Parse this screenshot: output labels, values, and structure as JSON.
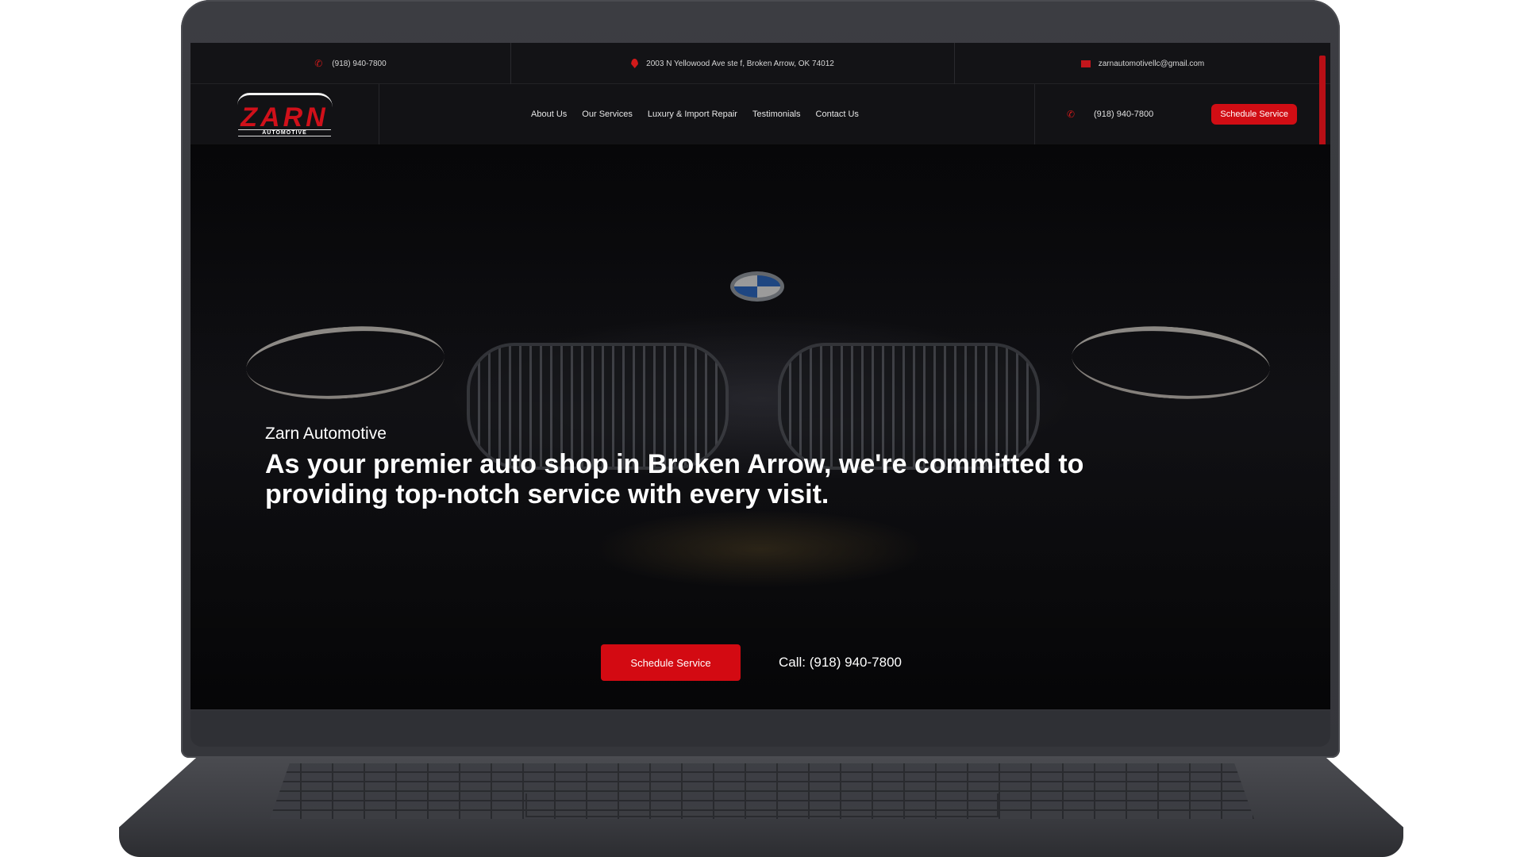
{
  "topbar": {
    "phone": "(918) 940-7800",
    "address": "2003 N Yellowood Ave ste f, Broken Arrow, OK 74012",
    "email": "zarnautomotivellc@gmail.com"
  },
  "brand": {
    "logo_text": "ZARN",
    "logo_subtext": "AUTOMOTIVE",
    "accent_color": "#d10d14"
  },
  "nav": {
    "items": [
      {
        "label": "About Us"
      },
      {
        "label": "Our Services"
      },
      {
        "label": "Luxury & Import Repair"
      },
      {
        "label": "Testimonials"
      },
      {
        "label": "Contact Us"
      }
    ],
    "phone": "(918) 940-7800",
    "cta_label": "Schedule Service"
  },
  "hero": {
    "kicker": "Zarn Automotive",
    "headline": "As your premier auto shop in Broken Arrow, we're committed to providing top-notch service with every visit.",
    "cta_label": "Schedule Service",
    "call_text": "Call: (918) 940-7800"
  },
  "icons": {
    "phone": "phone-icon",
    "location": "map-pin-icon",
    "email": "mail-icon"
  }
}
